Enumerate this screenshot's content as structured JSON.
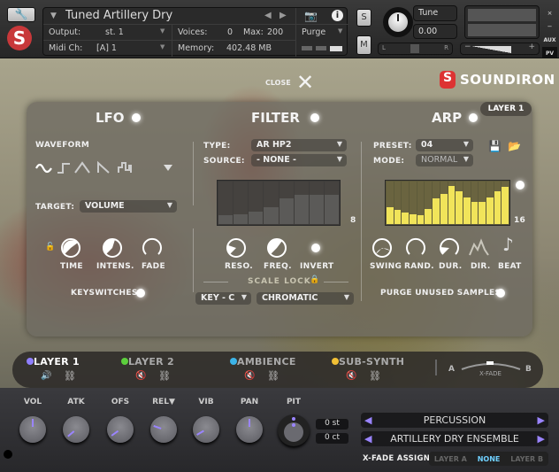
{
  "header": {
    "instrument_name": "Tuned Artillery Dry",
    "output_label": "Output:",
    "output_value": "st. 1",
    "midi_label": "Midi Ch:",
    "midi_value": "[A] 1",
    "voices_label": "Voices:",
    "voices_value": "0",
    "max_label": "Max:",
    "max_value": "200",
    "memory_label": "Memory:",
    "memory_value": "402.48 MB",
    "purge_label": "Purge",
    "solo_label": "S",
    "mute_label": "M",
    "tune_label": "Tune",
    "tune_value": "0.00",
    "pan_left": "L",
    "pan_right": "R",
    "aux_label": "AUX",
    "pv_label": "PV",
    "close_x": "×",
    "minimize": "−",
    "vol_minus": "−",
    "vol_plus": "+"
  },
  "brand": {
    "logo": "SOUNDIRON",
    "close_label": "CLOSE"
  },
  "lfo": {
    "title": "LFO",
    "waveform_label": "WAVEFORM",
    "target_label": "TARGET:",
    "target_value": "VOLUME",
    "knobs": [
      "TIME",
      "INTENS.",
      "FADE"
    ],
    "keyswitches_label": "KEYSWITCHES"
  },
  "filter": {
    "title": "FILTER",
    "type_label": "TYPE:",
    "type_value": "AR HP2",
    "source_label": "SOURCE:",
    "source_value": "- NONE -",
    "steps": "8",
    "step_values": [
      0.2,
      0.22,
      0.3,
      0.4,
      0.6,
      0.68,
      0.68,
      0.68
    ],
    "knobs": [
      "RESO.",
      "FREQ.",
      "INVERT"
    ],
    "scale_lock_label": "SCALE LOCK",
    "key_value": "KEY - C",
    "scale_value": "CHROMATIC"
  },
  "arp": {
    "title": "ARP",
    "layer_badge": "LAYER 1",
    "preset_label": "PRESET:",
    "preset_value": "04",
    "mode_label": "MODE:",
    "mode_value": "NORMAL",
    "steps": "16",
    "step_values": [
      0.4,
      0.33,
      0.27,
      0.22,
      0.2,
      0.35,
      0.6,
      0.7,
      0.9,
      0.78,
      0.63,
      0.53,
      0.53,
      0.63,
      0.78,
      0.88
    ],
    "knobs": [
      "SWING",
      "RAND.",
      "DUR.",
      "DIR.",
      "BEAT"
    ],
    "purge_label": "PURGE UNUSED SAMPLES"
  },
  "layers": [
    {
      "name": "LAYER 1",
      "color": "#8f7fff"
    },
    {
      "name": "LAYER 2",
      "color": "#5ccf3c"
    },
    {
      "name": "AMBIENCE",
      "color": "#3cb4e8"
    },
    {
      "name": "SUB-SYNTH",
      "color": "#f2c035"
    }
  ],
  "xfade": {
    "a": "A",
    "b": "B",
    "label": "X-FADE"
  },
  "bottom": {
    "knobs": [
      "VOL",
      "ATK",
      "OFS",
      "REL▼",
      "VIB",
      "PAN",
      "PIT"
    ],
    "pitch_st": "0 st",
    "pitch_ct": "0 ct",
    "category": "PERCUSSION",
    "patch": "ARTILLERY DRY ENSEMBLE",
    "xfade_assign_label": "X-FADE ASSIGN",
    "xfade_options": [
      "LAYER A",
      "NONE",
      "LAYER B"
    ],
    "accent": "#9a84ff"
  }
}
